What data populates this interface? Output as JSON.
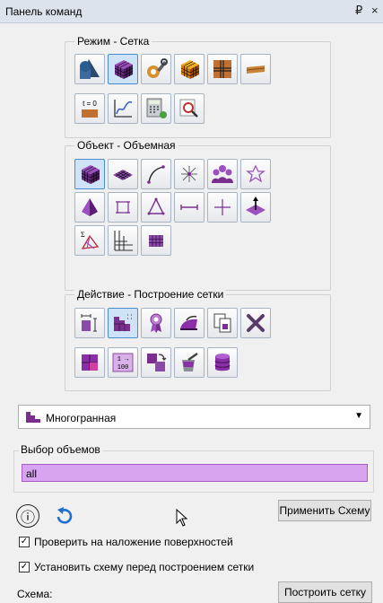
{
  "titlebar": {
    "title": "Панель команд",
    "dock_symbol": "₽",
    "close_symbol": "×"
  },
  "groups": {
    "mode": {
      "label": "Режим - Сетка"
    },
    "object": {
      "label": "Объект - Объемная"
    },
    "action": {
      "label": "Действие - Построение сетки"
    }
  },
  "mode_tools": {
    "t0_text": "t = 0"
  },
  "action_tools": {
    "counter_text_top": "1 →",
    "counter_text_bottom": "100"
  },
  "dropdown": {
    "value": "Многогранная",
    "arrow": "▼"
  },
  "volume_selection": {
    "label": "Выбор объемов",
    "value": "all"
  },
  "buttons": {
    "info": "ⓘ",
    "apply_scheme": "Применить Схему",
    "build_mesh": "Построить сетку"
  },
  "checkboxes": [
    {
      "label": "Проверить на наложение поверхностей",
      "checked": true
    },
    {
      "label": "Установить схему перед построением сетки",
      "checked": true
    }
  ],
  "schema": {
    "label": "Схема:"
  },
  "colors": {
    "accent": "#4a8bd4",
    "selection_fill": "#d8a4f0",
    "mesh_purple": "#7a2f8f",
    "titlebar": "#dde3ec"
  }
}
